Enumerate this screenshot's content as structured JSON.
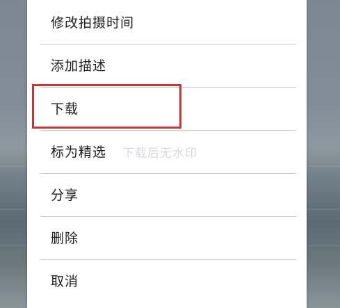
{
  "menu": {
    "items": [
      {
        "label": "修改拍摄时间"
      },
      {
        "label": "添加描述"
      },
      {
        "label": "下载"
      },
      {
        "label": "标为精选"
      },
      {
        "label": "分享"
      },
      {
        "label": "删除"
      },
      {
        "label": "取消"
      }
    ]
  },
  "watermark": {
    "text": "下载后无水印"
  },
  "colors": {
    "highlight_border": "#c0383a",
    "menu_background": "#ffffff",
    "divider": "#c9c9c9"
  }
}
